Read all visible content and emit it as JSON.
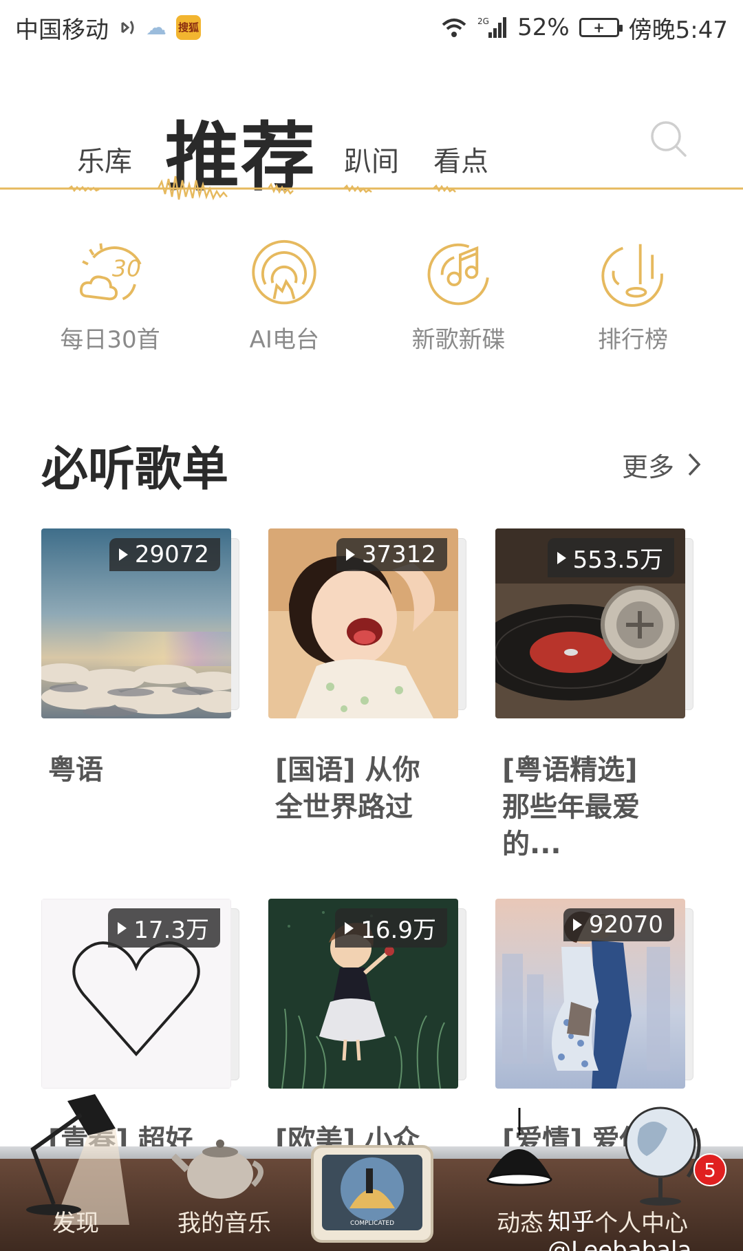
{
  "status_bar": {
    "carrier": "中国移动",
    "network": "2G",
    "battery": "52%",
    "time": "傍晚5:47",
    "app_badge": "搜狐"
  },
  "top_tabs": {
    "library": "乐库",
    "recommend": "推荐",
    "moments": "趴间",
    "watch": "看点"
  },
  "quick_entries": [
    {
      "label": "每日30首",
      "icon": "daily-30-icon"
    },
    {
      "label": "AI电台",
      "icon": "ai-radio-icon"
    },
    {
      "label": "新歌新碟",
      "icon": "new-music-icon"
    },
    {
      "label": "排行榜",
      "icon": "chart-icon"
    }
  ],
  "section": {
    "title": "必听歌单",
    "more": "更多"
  },
  "playlists": [
    {
      "title": "粤语",
      "plays": "29072",
      "cover": "sky-clouds"
    },
    {
      "title": "[国语] 从你全世界路过",
      "plays": "37312",
      "cover": "laughing-child"
    },
    {
      "title": "[粤语精选] 那些年最爱的...",
      "plays": "553.5万",
      "cover": "vinyl-record"
    },
    {
      "title": "[青春] 超好",
      "plays": "17.3万",
      "cover": "heart-outline"
    },
    {
      "title": "[欧美] 小众惊",
      "plays": "16.9万",
      "cover": "girl-in-field"
    },
    {
      "title": "[爱情] 爱你",
      "plays": "92070",
      "cover": "kissing-couple"
    }
  ],
  "bottom_nav": {
    "discover": "发现",
    "my_music": "我的音乐",
    "feed": "动态",
    "me": "个人中心",
    "badge": "5",
    "tv_text": "COMPLICATED"
  },
  "watermark": "知乎 @Leebabala",
  "colors": {
    "accent": "#e6b95e",
    "title": "#2a2a2a",
    "badge": "#e02020"
  }
}
